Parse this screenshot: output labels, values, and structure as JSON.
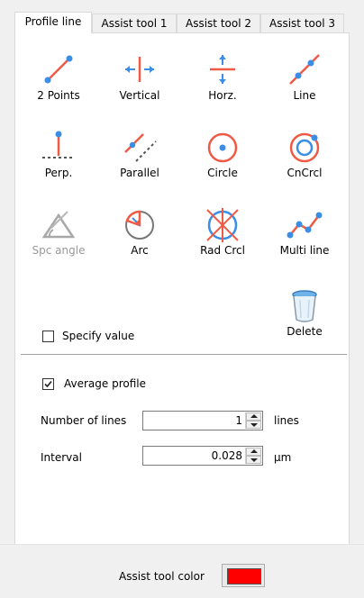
{
  "tabs": [
    "Profile line",
    "Assist tool 1",
    "Assist tool 2",
    "Assist tool 3"
  ],
  "tools": {
    "two_points": "2 Points",
    "vertical": "Vertical",
    "horz": "Horz.",
    "line": "Line",
    "perp": "Perp.",
    "parallel": "Parallel",
    "circle": "Circle",
    "cncrcl": "CnCrcl",
    "spc_angle": "Spc angle",
    "arc": "Arc",
    "rad_crcl": "Rad Crcl",
    "multi_line": "Multi line",
    "delete": "Delete"
  },
  "specify_value": {
    "label": "Specify value",
    "checked": false
  },
  "average_profile": {
    "label": "Average profile",
    "checked": true
  },
  "number_of_lines": {
    "label": "Number of lines",
    "value": "1",
    "unit": "lines"
  },
  "interval": {
    "label": "Interval",
    "value": "0.028",
    "unit": "µm"
  },
  "footer": {
    "label": "Assist tool color",
    "color": "#ff0000"
  },
  "colors": {
    "accent_red": "#f05a45",
    "accent_blue": "#3a8ee6"
  }
}
